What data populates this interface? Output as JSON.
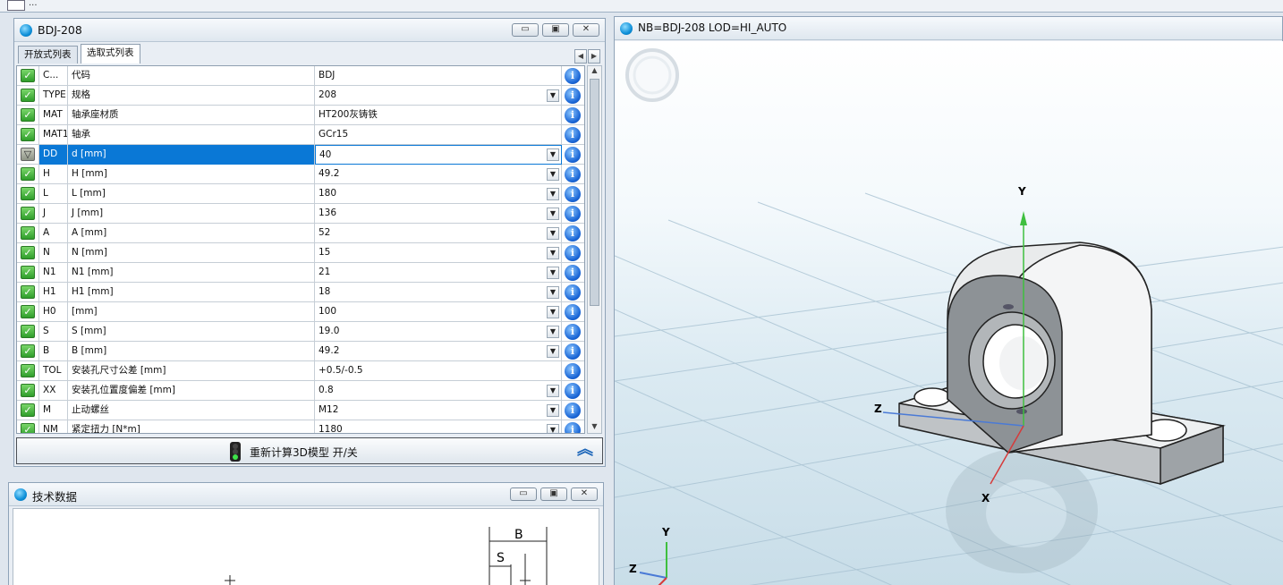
{
  "app": {
    "top_tab": "..."
  },
  "table_window": {
    "title": "BDJ-208",
    "buttons": {
      "minimize": "▭",
      "restore": "▣",
      "close": "✕"
    },
    "tabs": [
      {
        "label": "开放式列表",
        "active": false
      },
      {
        "label": "选取式列表",
        "active": true
      }
    ],
    "rows": [
      {
        "code": "C...",
        "name": "代码",
        "value": "BDJ",
        "dropdown": false,
        "selected": false
      },
      {
        "code": "TYPE",
        "name": "规格",
        "value": "208",
        "dropdown": true,
        "selected": false
      },
      {
        "code": "MAT",
        "name": "轴承座材质",
        "value": "HT200灰铸铁",
        "dropdown": false,
        "selected": false
      },
      {
        "code": "MAT1",
        "name": "轴承",
        "value": "GCr15",
        "dropdown": false,
        "selected": false
      },
      {
        "code": "DD",
        "name": "d [mm]",
        "value": "40",
        "dropdown": true,
        "selected": true
      },
      {
        "code": "H",
        "name": "H [mm]",
        "value": "49.2",
        "dropdown": true,
        "selected": false
      },
      {
        "code": "L",
        "name": "L [mm]",
        "value": "180",
        "dropdown": true,
        "selected": false
      },
      {
        "code": "J",
        "name": "J [mm]",
        "value": "136",
        "dropdown": true,
        "selected": false
      },
      {
        "code": "A",
        "name": "A [mm]",
        "value": "52",
        "dropdown": true,
        "selected": false
      },
      {
        "code": "N",
        "name": "N [mm]",
        "value": "15",
        "dropdown": true,
        "selected": false
      },
      {
        "code": "N1",
        "name": "N1 [mm]",
        "value": "21",
        "dropdown": true,
        "selected": false
      },
      {
        "code": "H1",
        "name": "H1 [mm]",
        "value": "18",
        "dropdown": true,
        "selected": false
      },
      {
        "code": "H0",
        "name": "[mm]",
        "value": "100",
        "dropdown": true,
        "selected": false
      },
      {
        "code": "S",
        "name": "S [mm]",
        "value": "19.0",
        "dropdown": true,
        "selected": false
      },
      {
        "code": "B",
        "name": "B [mm]",
        "value": "49.2",
        "dropdown": true,
        "selected": false
      },
      {
        "code": "TOL",
        "name": "安装孔尺寸公差 [mm]",
        "value": "+0.5/-0.5",
        "dropdown": false,
        "selected": false
      },
      {
        "code": "XX",
        "name": "安装孔位置度偏差 [mm]",
        "value": "0.8",
        "dropdown": true,
        "selected": false
      },
      {
        "code": "M",
        "name": "止动螺丝",
        "value": "M12",
        "dropdown": true,
        "selected": false
      },
      {
        "code": "NM",
        "name": "紧定扭力 [N*m]",
        "value": "1180",
        "dropdown": true,
        "selected": false
      }
    ],
    "recalc_label": "重新计算3D模型 开/关",
    "collapse_icon": "double-chevron-up-icon"
  },
  "tech_window": {
    "title": "技术数据",
    "buttons": {
      "minimize": "▭",
      "restore": "▣",
      "close": "✕"
    },
    "dims": {
      "b": "B",
      "s": "S"
    }
  },
  "view_window": {
    "title": "NB=BDJ-208 LOD=HI_AUTO",
    "axes": {
      "y": "Y",
      "z": "Z",
      "x": "X"
    },
    "mini_axes": {
      "y": "Y",
      "z": "Z"
    }
  }
}
